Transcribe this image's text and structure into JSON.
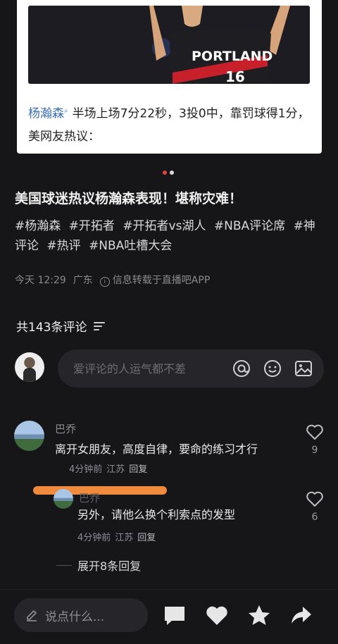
{
  "post": {
    "caption_tag": "杨瀚森",
    "caption_text": "半场上场7分22秒，3投0中，靠罚球得1分，美网友热议：",
    "jersey_team": "PORTLAND",
    "jersey_number": "16",
    "title": "美国球迷热议杨瀚森表现！堪称灾难！",
    "hashtags": [
      "#杨瀚森",
      "#开拓者",
      "#开拓者vs湖人",
      "#NBA评论席",
      "#神评论",
      "#热评",
      "#NBA吐槽大会"
    ],
    "time": "今天 12:29",
    "location": "广东",
    "source": "信息转载于直播吧APP"
  },
  "comments_header": {
    "label": "共143条评论"
  },
  "composer": {
    "placeholder": "爱评论的人运气都不差"
  },
  "comments": [
    {
      "name": "巴乔",
      "text": "离开女朋友，高度自律，要命的练习才行",
      "time": "4分钟前",
      "location": "江苏",
      "reply_label": "回复",
      "likes": "9"
    }
  ],
  "reply": {
    "name": "巴乔",
    "text": "另外，请他么换个利索点的发型",
    "time": "4分钟前",
    "location": "江苏",
    "reply_label": "回复",
    "likes": "6"
  },
  "expand_label": "展开8条回复",
  "bottom_bar": {
    "placeholder": "说点什么..."
  },
  "colors": {
    "background": "#161618",
    "tag_blue": "#3c6fb7",
    "active_dot": "#e8423f",
    "scribble": "#f08a3c"
  },
  "icons": {
    "info": "info-circle-icon",
    "sort": "sort-icon",
    "mention": "at-icon",
    "emoji": "emoji-icon",
    "image": "image-icon",
    "like": "heart-icon",
    "pencil": "pencil-icon"
  }
}
